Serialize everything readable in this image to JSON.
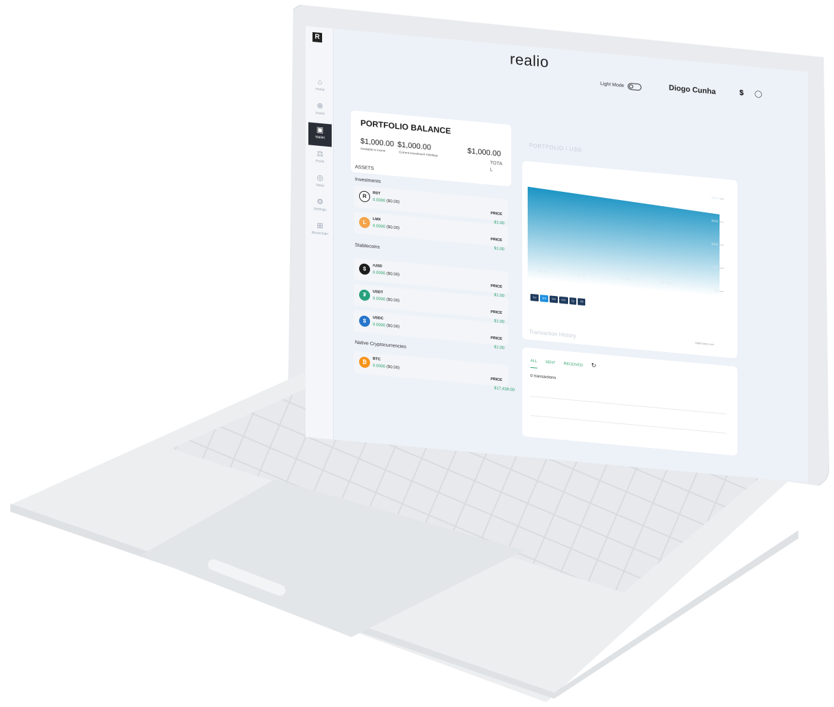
{
  "app": {
    "brand": "realio",
    "logo_mark": "R",
    "light_mode_label": "Light Mode",
    "user_name": "Diogo Cunha",
    "currency_symbol": "$",
    "user_icon": "user-icon"
  },
  "nav": {
    "items": [
      {
        "label": "Home",
        "icon": "home-icon",
        "glyph": "⌂"
      },
      {
        "label": "Invest",
        "icon": "invest-icon",
        "glyph": "⊕"
      },
      {
        "label": "Wallet",
        "icon": "wallet-icon",
        "glyph": "▣",
        "active": true
      },
      {
        "label": "Pools",
        "icon": "pools-icon",
        "glyph": "⚖"
      },
      {
        "label": "Value",
        "icon": "value-icon",
        "glyph": "◎"
      },
      {
        "label": "Settings",
        "icon": "settings-icon",
        "glyph": "⚙"
      },
      {
        "label": "Blockchain",
        "icon": "blockchain-icon",
        "glyph": "⊞"
      }
    ]
  },
  "portfolio": {
    "title": "PORTFOLIO BALANCE",
    "available_value": "$1,000.00",
    "available_label": "Available to invest",
    "holdings_value": "$1,000.00",
    "holdings_label": "Current Investment Holdings",
    "total_value": "$1,000.00",
    "total_label_1": "TOTA",
    "total_label_2": "L"
  },
  "assets": {
    "heading": "ASSETS",
    "groups": [
      {
        "label": "Investments"
      },
      {
        "label": "Stablecoins"
      },
      {
        "label": "Native Cryptocurrencies"
      }
    ],
    "items": [
      {
        "symbol": "RST",
        "balance": "0.0000",
        "usd": "($0.00)",
        "price_label": "PRICE",
        "price": "$1.00",
        "color": "#ffffff",
        "glyph": "R"
      },
      {
        "symbol": "LMX",
        "balance": "0.0000",
        "usd": "($0.00)",
        "price_label": "PRICE",
        "price": "$1.00",
        "color": "#f4a44a",
        "glyph": "L"
      },
      {
        "symbol": "rUSD",
        "balance": "0.0000",
        "usd": "($0.00)",
        "price_label": "PRICE",
        "price": "$1.00",
        "color": "#1c1c1c",
        "glyph": "$"
      },
      {
        "symbol": "USDT",
        "balance": "0.0000",
        "usd": "($0.00)",
        "price_label": "PRICE",
        "price": "$1.00",
        "color": "#26a17b",
        "glyph": "₮"
      },
      {
        "symbol": "USDC",
        "balance": "0.0000",
        "usd": "($0.00)",
        "price_label": "PRICE",
        "price": "$1.00",
        "color": "#2775ca",
        "glyph": "$"
      },
      {
        "symbol": "BTC",
        "balance": "0.0000",
        "usd": "($0.00)",
        "price_label": "PRICE",
        "price": "$17,438.00",
        "color": "#f7931a",
        "glyph": "₿"
      }
    ]
  },
  "chart": {
    "title": "PORTFOLIO / USD",
    "ranges": [
      "1w",
      "1m",
      "3m",
      "6m",
      "1y",
      "All"
    ],
    "active_range": "1m",
    "credits": "Highcharts.com",
    "gradient_top": "#1b94c4",
    "gradient_bottom": "#ffffff"
  },
  "chart_data": {
    "type": "area",
    "title": "PORTFOLIO / USD",
    "xlabel": "",
    "ylabel": "",
    "x": [
      "26. Jul",
      "9. Jul",
      "16. Aug",
      "30. Aug"
    ],
    "y_ticks": [
      "$20k",
      "$15k",
      "$10k",
      "$5k",
      "$0"
    ],
    "series": [
      {
        "values": [
          18000,
          17500,
          17000,
          16500,
          16000
        ]
      }
    ]
  },
  "transactions": {
    "title": "Transaction History",
    "tabs": [
      "ALL",
      "SENT",
      "RECEIVED"
    ],
    "active_tab": "ALL",
    "empty_text": "0 transactions"
  },
  "colors": {
    "accent_green": "#2ea36b",
    "nav_active": "#2a2f37",
    "range_active": "#1d8fe0"
  }
}
